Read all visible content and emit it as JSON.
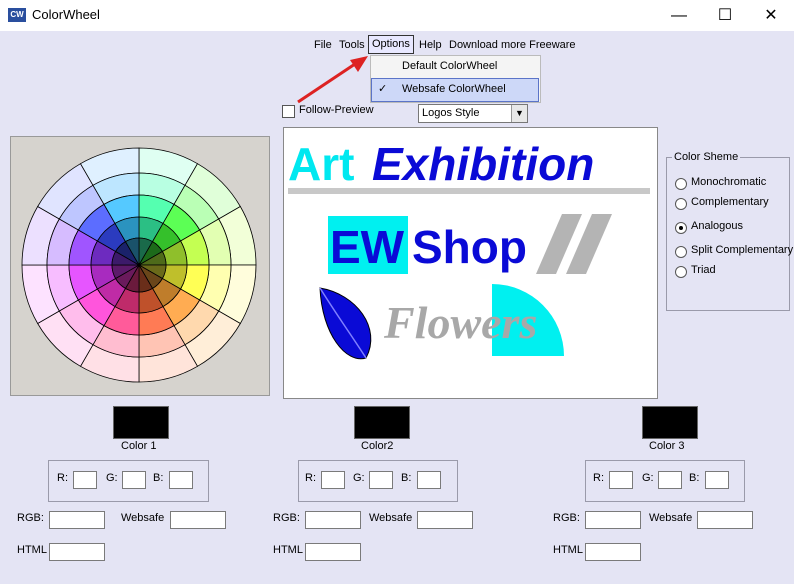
{
  "window": {
    "title": "ColorWheel",
    "icon_text": "CW",
    "minimize": "—",
    "maximize": "☐",
    "close": "✕"
  },
  "menu": {
    "file": "File",
    "tools": "Tools",
    "options": "Options",
    "help": "Help",
    "download": "Download more Freeware"
  },
  "dropdown": {
    "default": "Default ColorWheel",
    "websafe": "Websafe ColorWheel",
    "check": "✓"
  },
  "follow_preview": "Follow-Preview",
  "style_select": {
    "value": "Logos Style",
    "arrow": "▼"
  },
  "preview": {
    "art": "Art",
    "exhibition": "Exhibition",
    "ew": "EW",
    "shop": "Shop",
    "flowers": "Flowers"
  },
  "scheme": {
    "title": "Color Sheme",
    "options": [
      "Monochromatic",
      "Complementary",
      "Analogous",
      "Split Complementary",
      "Triad"
    ],
    "selected": "Analogous"
  },
  "colors": [
    {
      "label": "Color 1",
      "r": "R:",
      "g": "G:",
      "b": "B:",
      "rgb": "RGB:",
      "websafe": "Websafe",
      "html": "HTML"
    },
    {
      "label": "Color2",
      "r": "R:",
      "g": "G:",
      "b": "B:",
      "rgb": "RGB:",
      "websafe": "Websafe",
      "html": "HTML"
    },
    {
      "label": "Color 3",
      "r": "R:",
      "g": "G:",
      "b": "B:",
      "rgb": "RGB:",
      "websafe": "Websafe",
      "html": "HTML"
    }
  ],
  "wheel_colors": {
    "outer": [
      "#dffff2",
      "#e0ffd9",
      "#f2ffd8",
      "#fffddc",
      "#ffeed8",
      "#ffe4da",
      "#ffe0e6",
      "#ffe0f4",
      "#fde2ff",
      "#ece0ff",
      "#e0e4ff",
      "#dff0ff"
    ],
    "ring2": [
      "#b8ffe2",
      "#baffb5",
      "#e2ffb2",
      "#ffffb0",
      "#ffd9ae",
      "#ffc4b4",
      "#ffbdd0",
      "#ffbdec",
      "#f7bdff",
      "#d6bcff",
      "#bec6ff",
      "#bde6ff"
    ],
    "ring3": [
      "#55ffb0",
      "#5cff55",
      "#c4ff52",
      "#ffff55",
      "#ffac52",
      "#ff7b55",
      "#ff5b9a",
      "#ff55dc",
      "#e655ff",
      "#a055ff",
      "#5c6dff",
      "#55c9ff"
    ],
    "ring4": [
      "#2bbf84",
      "#35c02b",
      "#8fbf2b",
      "#bfbf2b",
      "#bf7d2b",
      "#bf512b",
      "#bf2b6a",
      "#bf2ba6",
      "#a82bbf",
      "#6d2bbf",
      "#2b3bbf",
      "#2b93bf"
    ],
    "inner": [
      "#1a6a4a",
      "#1d6a1a",
      "#4e6a1a",
      "#6a6a1a",
      "#6a461a",
      "#6a2e1a",
      "#6a1a3c",
      "#6a1a5c",
      "#5c1a6a",
      "#3c1a6a",
      "#1a226a",
      "#1a526a"
    ]
  }
}
